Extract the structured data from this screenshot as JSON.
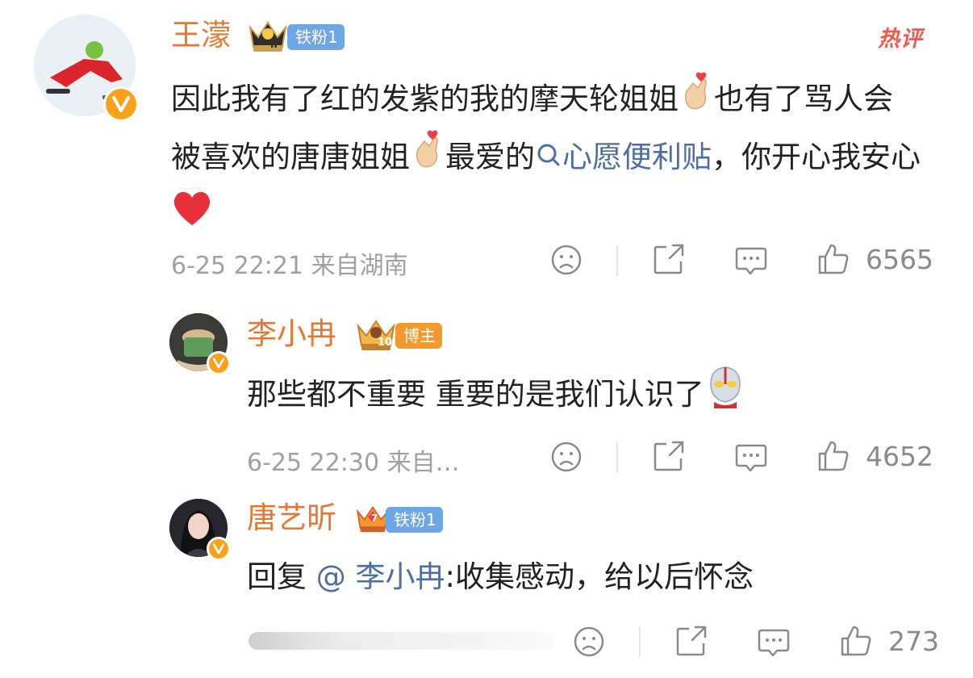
{
  "hot_badge": "热评",
  "comments": [
    {
      "username": "王濛",
      "medal_level": "II",
      "fan_badge": "铁粉1",
      "text_parts": [
        "因此我有了红的发紫的我的摩天轮姐姐",
        "也有了骂人会被喜欢的唐唐姐姐",
        "最爱的",
        "心愿便利贴",
        "，你开心我安心"
      ],
      "time": "6-25 22:21",
      "location": "来自湖南",
      "likes": "6565"
    },
    {
      "username": "李小冉",
      "medal_level": "10",
      "fan_badge": "博主",
      "text": "那些都不重要 重要的是我们认识了",
      "time": "6-25 22:30",
      "location": "来自…",
      "likes": "4652"
    },
    {
      "username": "唐艺昕",
      "medal_level": "7",
      "fan_badge": "铁粉1",
      "reply_prefix": "回复",
      "mention": "@ 李小冉",
      "reply_text": ":收集感动，给以后怀念",
      "likes": "273"
    }
  ],
  "icons": {
    "dislike": "sad-face-icon",
    "share": "share-icon",
    "reply": "comment-bubble-icon",
    "like": "thumbs-up-icon",
    "verified": "verified-v-icon"
  },
  "colors": {
    "username": "#e8762f",
    "link": "#4e6ea3",
    "iron_fan_badge": "#6ea7e8",
    "host_badge": "#f29a2e",
    "hot": "#ee5b4e",
    "meta": "#a0a0a0"
  }
}
